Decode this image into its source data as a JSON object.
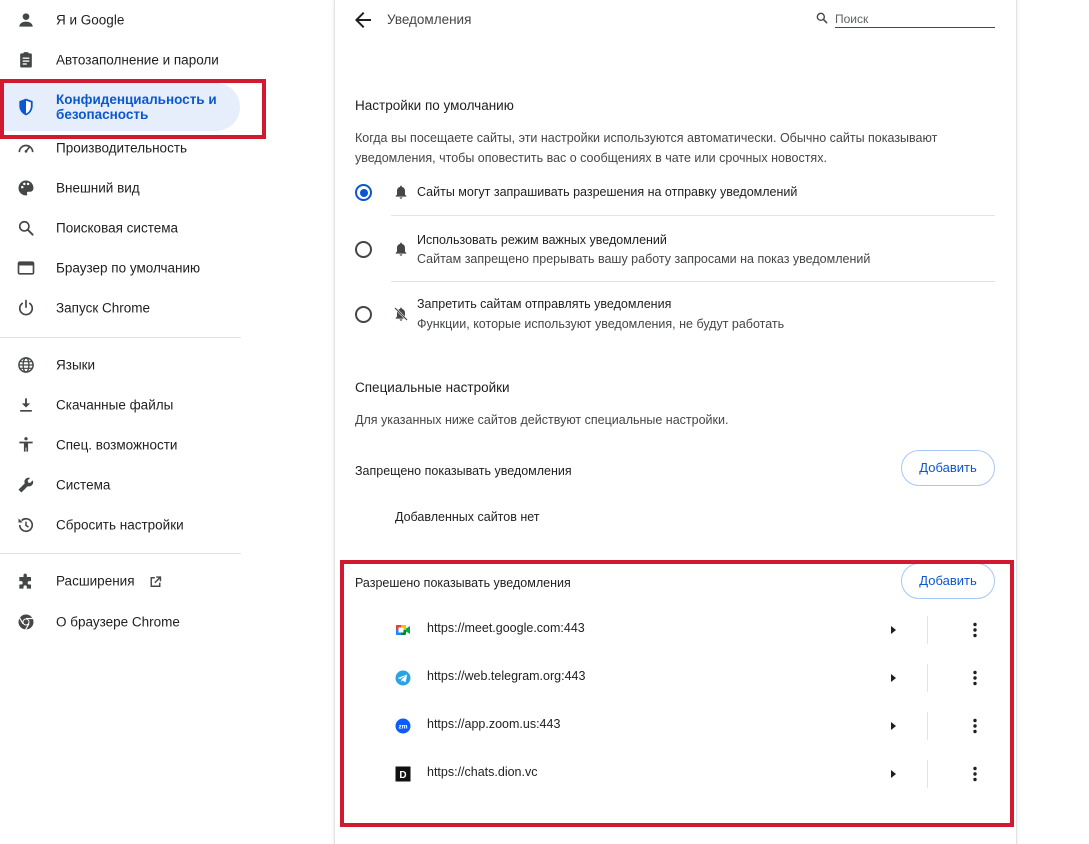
{
  "sidebar": {
    "items": [
      {
        "label": "Я и Google",
        "icon": "person-icon"
      },
      {
        "label": "Автозаполнение и пароли",
        "icon": "clipboard-icon"
      },
      {
        "label": "Конфиденциальность и безопасность",
        "icon": "shield-icon",
        "active": true
      },
      {
        "label": "Производительность",
        "icon": "speedometer-icon"
      },
      {
        "label": "Внешний вид",
        "icon": "palette-icon"
      },
      {
        "label": "Поисковая система",
        "icon": "search-icon"
      },
      {
        "label": "Браузер по умолчанию",
        "icon": "browser-window-icon"
      },
      {
        "label": "Запуск Chrome",
        "icon": "power-icon"
      },
      {
        "label": "Языки",
        "icon": "globe-icon"
      },
      {
        "label": "Скачанные файлы",
        "icon": "download-icon"
      },
      {
        "label": "Спец. возможности",
        "icon": "accessibility-icon"
      },
      {
        "label": "Система",
        "icon": "wrench-icon"
      },
      {
        "label": "Сбросить настройки",
        "icon": "history-icon"
      },
      {
        "label": "Расширения",
        "icon": "puzzle-icon"
      },
      {
        "label": "О браузере Chrome",
        "icon": "chrome-icon"
      }
    ]
  },
  "header": {
    "title": "Уведомления",
    "search_placeholder": "Поиск"
  },
  "defaults": {
    "heading": "Настройки по умолчанию",
    "description": "Когда вы посещаете сайты, эти настройки используются автоматически. Обычно сайты показывают уведомления, чтобы оповестить вас о сообщениях в чате или срочных новостях.",
    "options": [
      {
        "label": "Сайты могут запрашивать разрешения на отправку уведомлений",
        "sub": "",
        "checked": true,
        "icon": "bell-icon"
      },
      {
        "label": "Использовать режим важных уведомлений",
        "sub": "Сайтам запрещено прерывать вашу работу запросами на показ уведомлений",
        "checked": false,
        "icon": "bell-icon"
      },
      {
        "label": "Запретить сайтам отправлять уведомления",
        "sub": "Функции, которые используют уведомления, не будут работать",
        "checked": false,
        "icon": "bell-off-icon"
      }
    ]
  },
  "custom": {
    "heading": "Специальные настройки",
    "description": "Для указанных ниже сайтов действуют специальные настройки.",
    "blocked": {
      "label": "Запрещено показывать уведомления",
      "add_label": "Добавить",
      "empty": "Добавленных сайтов нет"
    },
    "allowed": {
      "label": "Разрешено показывать уведомления",
      "add_label": "Добавить",
      "sites": [
        {
          "url": "https://meet.google.com:443",
          "icon": "google-meet-icon"
        },
        {
          "url": "https://web.telegram.org:443",
          "icon": "telegram-icon"
        },
        {
          "url": "https://app.zoom.us:443",
          "icon": "zoom-icon"
        },
        {
          "url": "https://chats.dion.vc",
          "icon": "dion-icon"
        }
      ]
    }
  },
  "colors": {
    "accent": "#0b57d0",
    "active_bg": "#e6eefc",
    "highlight_border": "#d1192f"
  }
}
